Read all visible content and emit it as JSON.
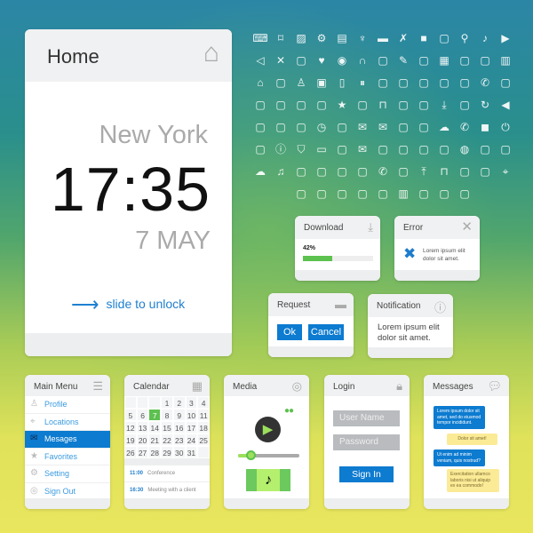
{
  "home": {
    "title": "Home",
    "city": "New York",
    "time": "17:35",
    "date": "7 MAY",
    "unlock": "slide to unlock"
  },
  "icons": [
    [
      "keyboard",
      "tag",
      "image",
      "gear",
      "book",
      "lamp",
      "folder",
      "tools",
      "camera",
      "chart-stand",
      "search",
      "music-note",
      "play"
    ],
    [
      "volume",
      "mute",
      "paperclip-stack",
      "heart",
      "disc",
      "headphones",
      "paperclip",
      "pencil",
      "skip-back",
      "calculator",
      "zoom-in",
      "zoom-out",
      "film"
    ],
    [
      "home",
      "mouse",
      "user",
      "floppy",
      "tablet",
      "pause",
      "cassette",
      "wifi",
      "eject",
      "film-reel",
      "cd",
      "phone",
      "eraser"
    ],
    [
      "microphone",
      "usb",
      "calendar",
      "clapper",
      "star",
      "mobile",
      "unlock",
      "target",
      "folder-open",
      "download",
      "user-tie",
      "refresh",
      "rewind"
    ],
    [
      "mic",
      "sitemap",
      "antenna",
      "clock",
      "printer",
      "mail-out",
      "mail-in",
      "laptop",
      "cellphone",
      "cloud",
      "phone-call",
      "stop",
      "power"
    ],
    [
      "equalizer",
      "info",
      "shield",
      "monitor",
      "rss",
      "mail",
      "jar",
      "smartphone",
      "radio",
      "document",
      "globe",
      "window",
      "fast-forward"
    ],
    [
      "chat",
      "music",
      "sliders",
      "briefcase",
      "joystick",
      "file",
      "phone-ring",
      "toggle",
      "upload",
      "lock",
      "play-circle",
      "notebook",
      "map-pin"
    ],
    [
      "router",
      "tv",
      "speech",
      "bar-chart",
      "webcam",
      "trash",
      "box",
      "battery",
      "walkie"
    ]
  ],
  "download": {
    "title": "Download",
    "percent_label": "42%",
    "progress": 0.42
  },
  "error": {
    "title": "Error",
    "message": "Lorem ipsum elit dolor sit amet."
  },
  "request": {
    "title": "Request",
    "ok": "Ok",
    "cancel": "Cancel"
  },
  "notification": {
    "title": "Notification",
    "message": "Lorem ipsum elit dolor sit amet."
  },
  "main_menu": {
    "title": "Main Menu",
    "items": [
      {
        "label": "Profile"
      },
      {
        "label": "Locations"
      },
      {
        "label": "Mesages"
      },
      {
        "label": "Favorites"
      },
      {
        "label": "Setting"
      },
      {
        "label": "Sign Out"
      }
    ],
    "active": 2
  },
  "calendar": {
    "title": "Calendar",
    "selected": "7",
    "days": [
      "",
      "",
      "",
      "1",
      "2",
      "3",
      "4",
      "5",
      "6",
      "7",
      "8",
      "9",
      "10",
      "11",
      "12",
      "13",
      "14",
      "15",
      "16",
      "17",
      "18",
      "19",
      "20",
      "21",
      "22",
      "23",
      "24",
      "25",
      "26",
      "27",
      "28",
      "29",
      "30",
      "31",
      ""
    ],
    "events": [
      {
        "time": "11:00",
        "title": "Conference"
      },
      {
        "time": "16:30",
        "title": "Meeting with a client"
      }
    ]
  },
  "media": {
    "title": "Media",
    "progress": 0.2
  },
  "login": {
    "title": "Login",
    "username_placeholder": "User Name",
    "password_placeholder": "Password",
    "sign_in": "Sign In"
  },
  "messages": {
    "title": "Messages",
    "items": [
      {
        "text": "Lorem ipsum dolor sit amet, sed do eiusmod tempor incididunt.",
        "side": "left"
      },
      {
        "text": "Dolor sit amet!",
        "side": "right"
      },
      {
        "text": "Ut enim ad minim veniam, quis nostrud?",
        "side": "left"
      },
      {
        "text": "Exercitation ullamco laboris nisi ut aliquip ex ea commodo!",
        "side": "right"
      }
    ]
  },
  "colors": {
    "accent": "#0c7bd0",
    "green": "#5dc14f",
    "media_green": "#9be05c"
  }
}
